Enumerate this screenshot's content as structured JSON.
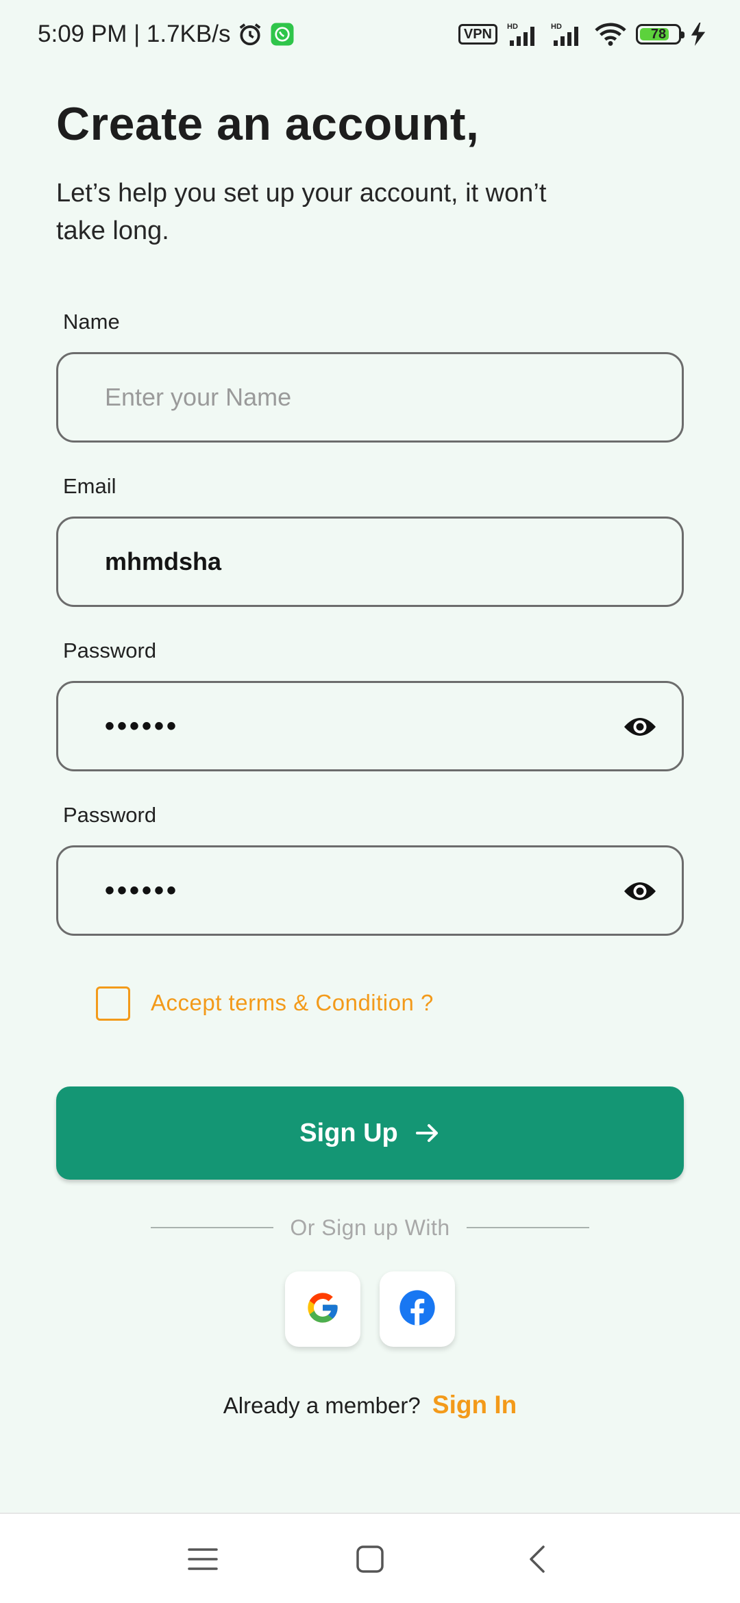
{
  "status_bar": {
    "time_speed": "5:09 PM | 1.7KB/s",
    "vpn": "VPN",
    "hd1": "HD",
    "hd2": "HD",
    "battery_level": "78",
    "battery_fraction": 0.78,
    "icons": [
      "alarm-icon",
      "whatsapp-icon",
      "signal-icon",
      "wifi-icon",
      "battery-icon",
      "charging-icon"
    ]
  },
  "header": {
    "title": "Create an account,",
    "subtitle": "Let’s help you set up your account, it won’t take long."
  },
  "form": {
    "name_label": "Name",
    "name_placeholder": "Enter your Name",
    "email_label": "Email",
    "email_value": "mhmdsha",
    "password_label": "Password",
    "password_value": "••••••",
    "confirm_password_label": "Password",
    "confirm_password_value": "••••••",
    "terms_label": "Accept terms & Condition ?",
    "terms_checked": false
  },
  "actions": {
    "signup_label": "Sign Up",
    "divider_text": "Or Sign up With",
    "member_text": "Already a member?",
    "signin_label": "Sign In"
  },
  "social": [
    "google-icon",
    "facebook-icon"
  ],
  "colors": {
    "background": "#f1f9f4",
    "primary": "#149674",
    "accent": "#f39a1a",
    "facebook": "#1877f2"
  },
  "nav": [
    "menu-icon",
    "home-icon",
    "back-icon"
  ]
}
